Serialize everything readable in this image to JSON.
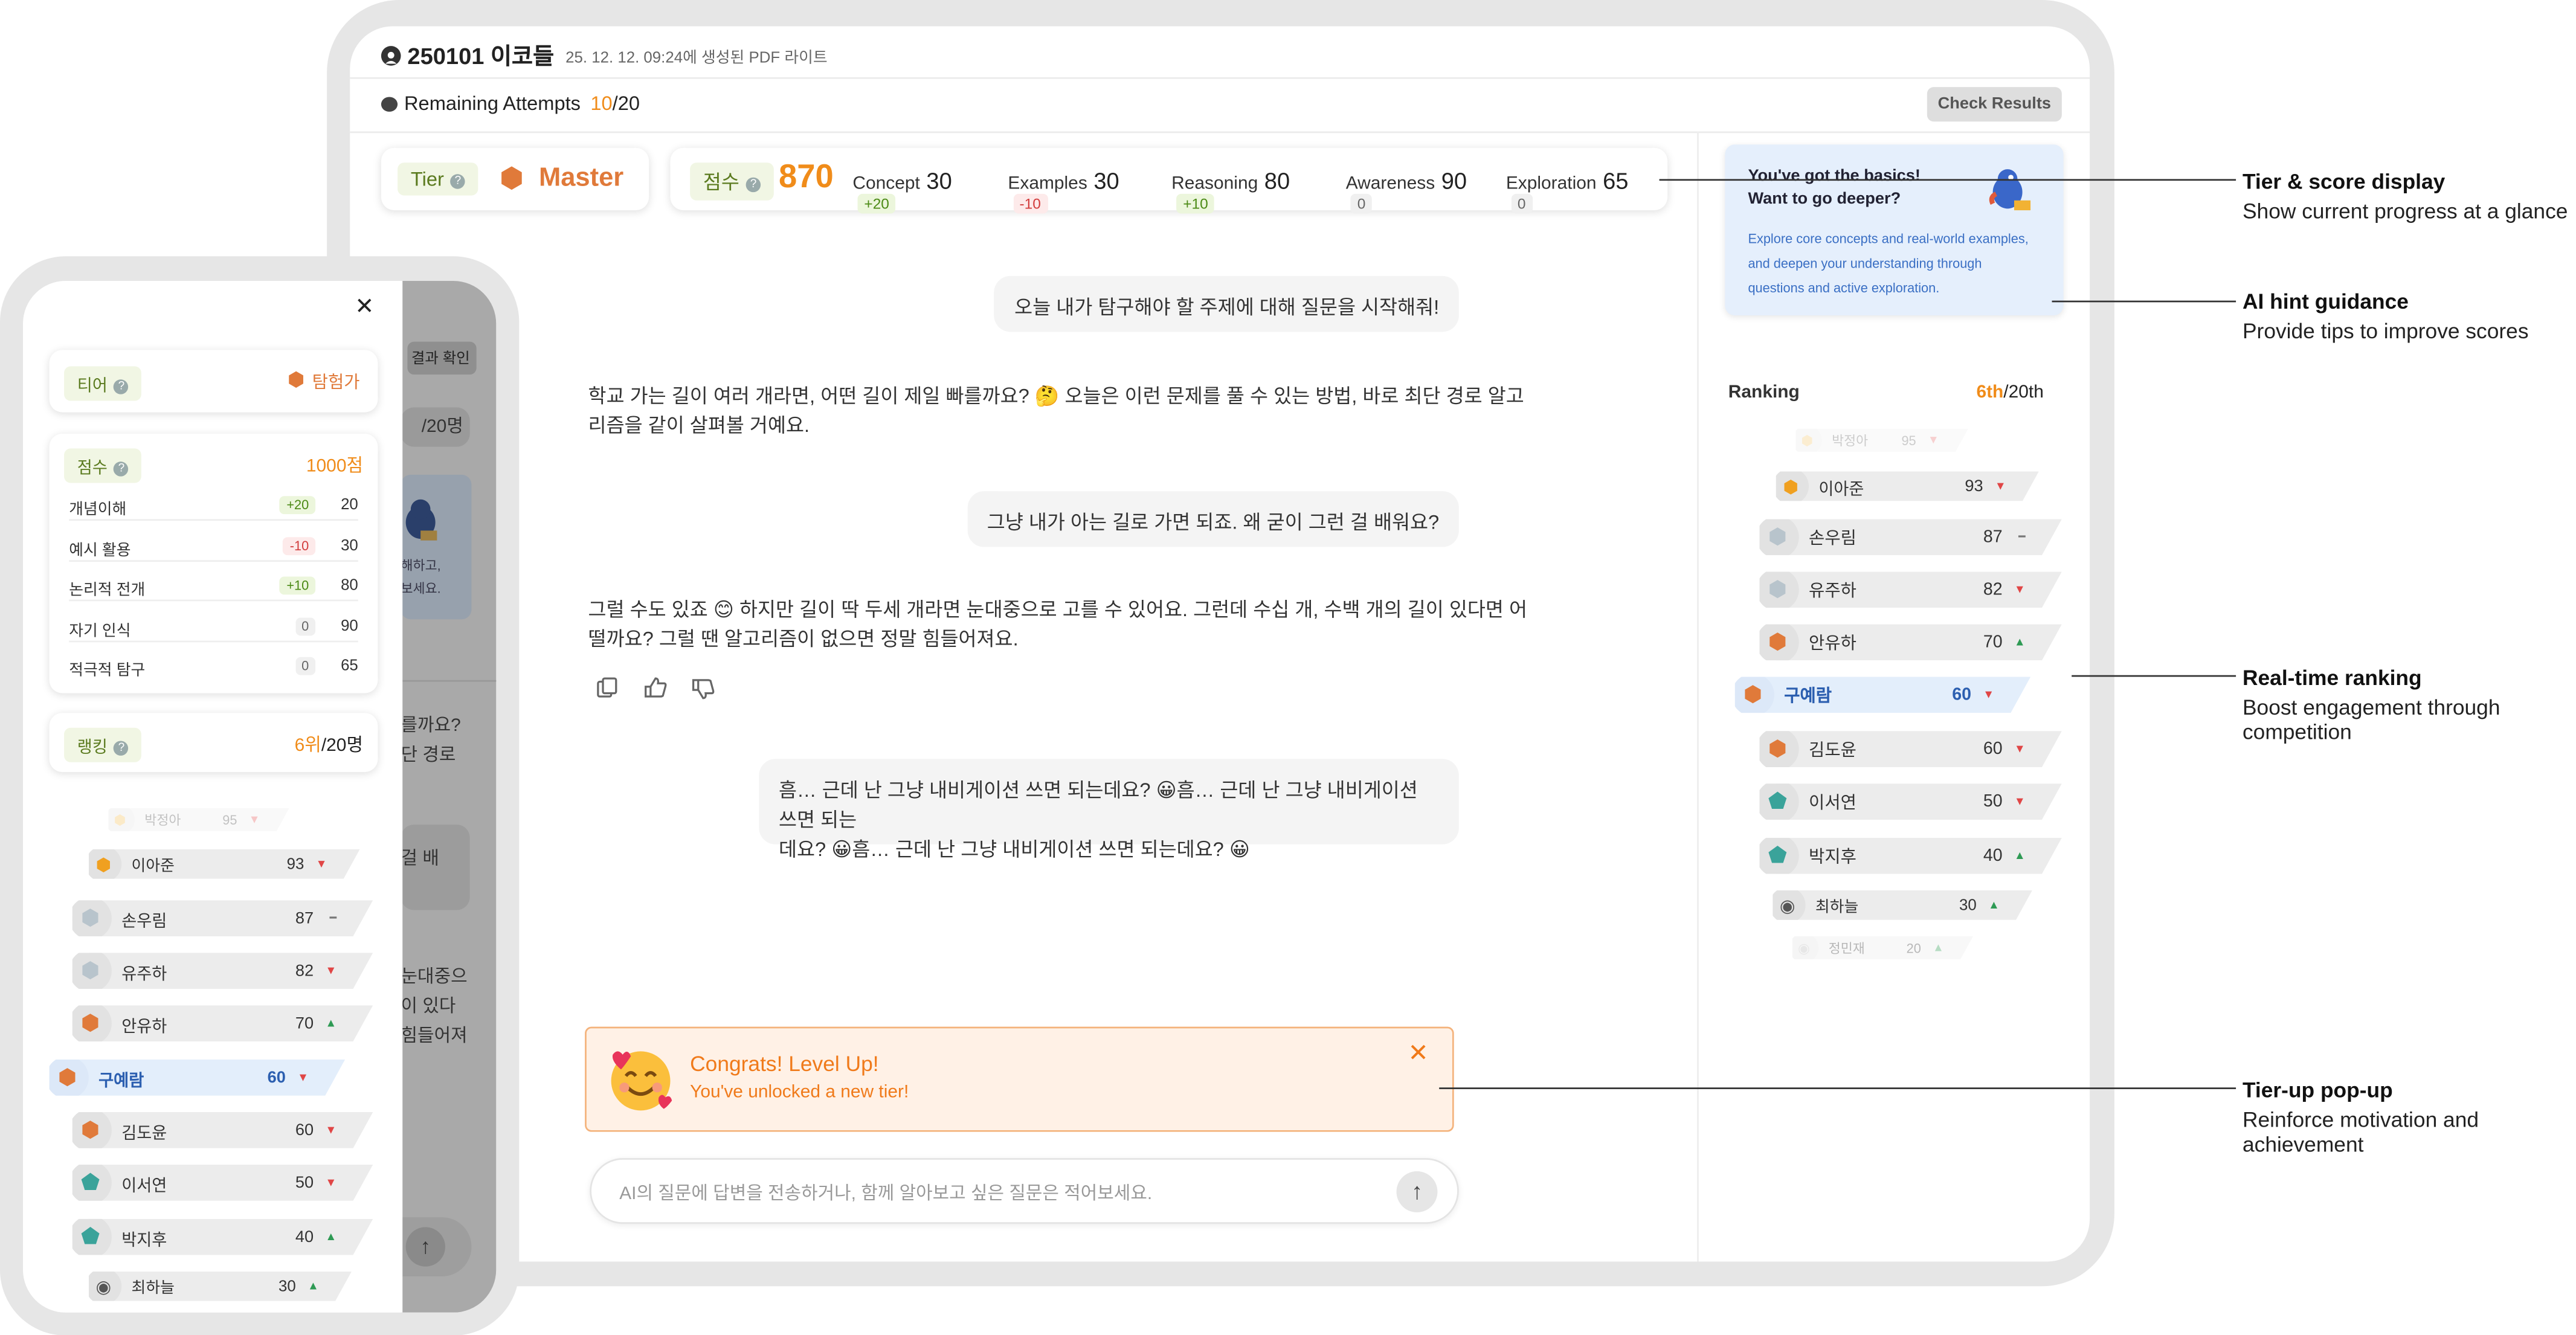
{
  "header": {
    "title": "250101 이코들",
    "subtitle": "25. 12. 12. 09:24에 생성된 PDF 라이트"
  },
  "attempts": {
    "label": "Remaining Attempts",
    "used": "10",
    "total": "/20",
    "button": "Check Results"
  },
  "tier": {
    "label": "Tier",
    "value": "Master"
  },
  "score": {
    "label": "점수",
    "value": "870",
    "items": [
      {
        "name": "Concept",
        "value": "30",
        "delta": "+20",
        "kind": "pos"
      },
      {
        "name": "Examples",
        "value": "30",
        "delta": "-10",
        "kind": "neg"
      },
      {
        "name": "Reasoning",
        "value": "80",
        "delta": "+10",
        "kind": "pos"
      },
      {
        "name": "Awareness",
        "value": "90",
        "delta": "0",
        "kind": "zero"
      },
      {
        "name": "Exploration",
        "value": "65",
        "delta": "0",
        "kind": "zero"
      }
    ]
  },
  "hint": {
    "title1": "You've got the basics!",
    "title2": "Want to go deeper?",
    "body": "Explore core concepts and real-world examples, and deepen your understanding through questions and active exploration."
  },
  "chat": {
    "user1": "오늘 내가 탐구해야 할 주제에 대해 질문을 시작해줘!",
    "ai1a": "학교 가는 길이 여러 개라면, 어떤 길이 제일 빠를까요? 🤔 오늘은 이런 문제를 풀 수 있는 방법, 바로 최단 경로 알고",
    "ai1b": "리즘을 같이 살펴볼 거예요.",
    "user2": "그냥 내가 아는 길로 가면 되죠. 왜 굳이 그런 걸 배워요?",
    "ai2a": "그럴 수도 있죠 😊 하지만 길이 딱 두세 개라면 눈대중으로 고를 수 있어요. 그런데 수십 개, 수백 개의 길이 있다면 어",
    "ai2b": "떨까요? 그럴 땐 알고리즘이 없으면 정말 힘들어져요.",
    "user3a": "흠… 근데 난 그냥 내비게이션 쓰면 되는데요? 😀흠… 근데 난 그냥 내비게이션 쓰면 되는",
    "user3b": "데요? 😀흠… 근데 난 그냥 내비게이션 쓰면 되는데요? 😀",
    "placeholder": "AI의 질문에 답변을 전송하거나, 함께 알아보고 싶은 질문은 적어보세요."
  },
  "popup": {
    "title": "Congrats! Level Up!",
    "subtitle": "You've unlocked a new tier!"
  },
  "ranking": {
    "label": "Ranking",
    "rank": "6th",
    "total": "/20th",
    "rows": [
      {
        "name": "박정아",
        "score": "95",
        "trend": "down"
      },
      {
        "name": "이아준",
        "score": "93",
        "trend": "down"
      },
      {
        "name": "손우림",
        "score": "87",
        "trend": "same"
      },
      {
        "name": "유주하",
        "score": "82",
        "trend": "down"
      },
      {
        "name": "안유하",
        "score": "70",
        "trend": "up"
      },
      {
        "name": "구예람",
        "score": "60",
        "trend": "down"
      },
      {
        "name": "김도윤",
        "score": "60",
        "trend": "down"
      },
      {
        "name": "이서연",
        "score": "50",
        "trend": "down"
      },
      {
        "name": "박지후",
        "score": "40",
        "trend": "up"
      },
      {
        "name": "최하늘",
        "score": "30",
        "trend": "up"
      },
      {
        "name": "정민재",
        "score": "20",
        "trend": "up"
      }
    ]
  },
  "annotations": [
    {
      "title": "Tier & score display",
      "desc": "Show current progress at a glance"
    },
    {
      "title": "AI hint guidance",
      "desc": "Provide tips to improve scores"
    },
    {
      "title": "Real-time ranking",
      "desc1": "Boost engagement through",
      "desc2": "competition"
    },
    {
      "title": "Tier-up pop-up",
      "desc1": "Reinforce motivation and",
      "desc2": "achievement"
    }
  ],
  "mobile": {
    "tier_label": "티어",
    "tier_value": "탐험가",
    "score_label": "점수",
    "score_value": "1000점",
    "score_items": [
      {
        "name": "개념이해",
        "delta": "+20",
        "value": "20",
        "kind": "pos"
      },
      {
        "name": "예시 활용",
        "delta": "-10",
        "value": "30",
        "kind": "neg"
      },
      {
        "name": "논리적 전개",
        "delta": "+10",
        "value": "80",
        "kind": "pos"
      },
      {
        "name": "자기 인식",
        "delta": "0",
        "value": "90",
        "kind": "zero"
      },
      {
        "name": "적극적 탐구",
        "delta": "0",
        "value": "65",
        "kind": "zero"
      }
    ],
    "rank_label": "랭킹",
    "rank_value": "6위",
    "rank_total": "/20명",
    "behind": {
      "btn": "결과 확인",
      "count": "/20명",
      "t1": "해하고,",
      "t2": "보세요.",
      "c1": "를까요?",
      "c2": "단 경로",
      "c3": "걸 배",
      "c4": "눈대중으",
      "c5": "이 있다",
      "c6": "힘들어져"
    }
  }
}
